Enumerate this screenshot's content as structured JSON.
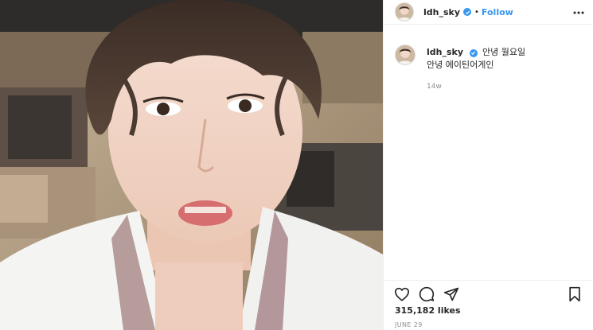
{
  "post": {
    "image_alt": "selfie photo in a car"
  },
  "header": {
    "username": "ldh_sky",
    "verified": true,
    "separator": "•",
    "follow_label": "Follow",
    "more_icon": "more-horizontal-icon"
  },
  "caption": {
    "username": "ldh_sky",
    "line1": "안녕 월요일",
    "line2": "안녕 에이틴어게인",
    "time_ago": "14w"
  },
  "actions": {
    "like_icon": "heart-icon",
    "comment_icon": "comment-icon",
    "share_icon": "paper-plane-icon",
    "save_icon": "bookmark-icon"
  },
  "likes": {
    "text": "315,182 likes",
    "count": 315182
  },
  "date": {
    "text": "JUNE 29"
  },
  "colors": {
    "follow": "#3897f0",
    "verified": "#3897f0",
    "muted": "#8e8e8e",
    "text": "#262626",
    "border": "#efefef"
  }
}
